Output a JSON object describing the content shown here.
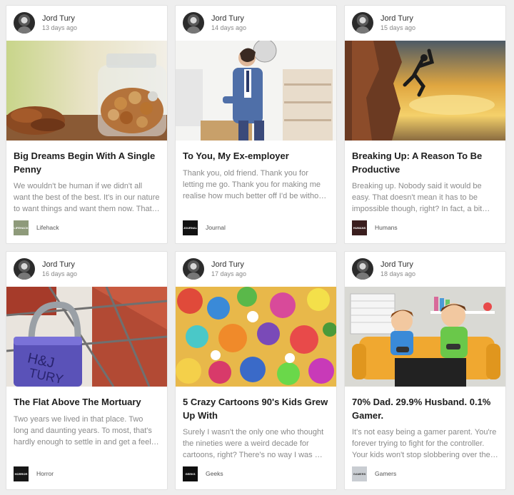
{
  "cards": [
    {
      "author": "Jord Tury",
      "date": "13 days ago",
      "title": "Big Dreams Begin With A Single Penny",
      "excerpt": "We wouldn't be human if we didn't all want the best of the best. It's in our nature to want things and want them now. That …",
      "category": "Lifehack",
      "logo_text": "LIFEHACK"
    },
    {
      "author": "Jord Tury",
      "date": "14 days ago",
      "title": "To You, My Ex-employer",
      "excerpt": "Thank you, old friend. Thank you for letting me go. Thank you for making me realise how much better off I'd be without you. …",
      "category": "Journal",
      "logo_text": "JOURNAL"
    },
    {
      "author": "Jord Tury",
      "date": "15 days ago",
      "title": "Breaking Up: A Reason To Be Productive",
      "excerpt": "Breaking up. Nobody said it would be easy. That doesn't mean it has to be impossible though, right? In fact, a bit of…",
      "category": "Humans",
      "logo_text": "HUMANS"
    },
    {
      "author": "Jord Tury",
      "date": "16 days ago",
      "title": "The Flat Above The Mortuary",
      "excerpt": "Two years we lived in that place. Two long and daunting years. To most, that's hardly enough to settle in and get a feel for the …",
      "category": "Horror",
      "logo_text": "HORROR"
    },
    {
      "author": "Jord Tury",
      "date": "17 days ago",
      "title": "5 Crazy Cartoons 90's Kids Grew Up With",
      "excerpt": "Surely I wasn't the only one who thought the nineties were a weird decade for cartoons, right? There's no way I was …",
      "category": "Geeks",
      "logo_text": "GEEKS"
    },
    {
      "author": "Jord Tury",
      "date": "18 days ago",
      "title": "70% Dad. 29.9% Husband. 0.1% Gamer.",
      "excerpt": "It's not easy being a gamer parent. You're forever trying to fight for the controller. Your kids won't stop slobbering over the …",
      "category": "Gamers",
      "logo_text": "GAMERS"
    }
  ],
  "colors": {
    "page_background": "#eeeeee",
    "card_background": "#ffffff",
    "title_text": "#1d1d1d",
    "excerpt_text": "#8a8a8a"
  },
  "icons": [
    "author-avatar-icon",
    "lifehack-logo-icon",
    "journal-logo-icon",
    "humans-logo-icon",
    "horror-logo-icon",
    "geeks-logo-icon",
    "gamers-logo-icon"
  ]
}
